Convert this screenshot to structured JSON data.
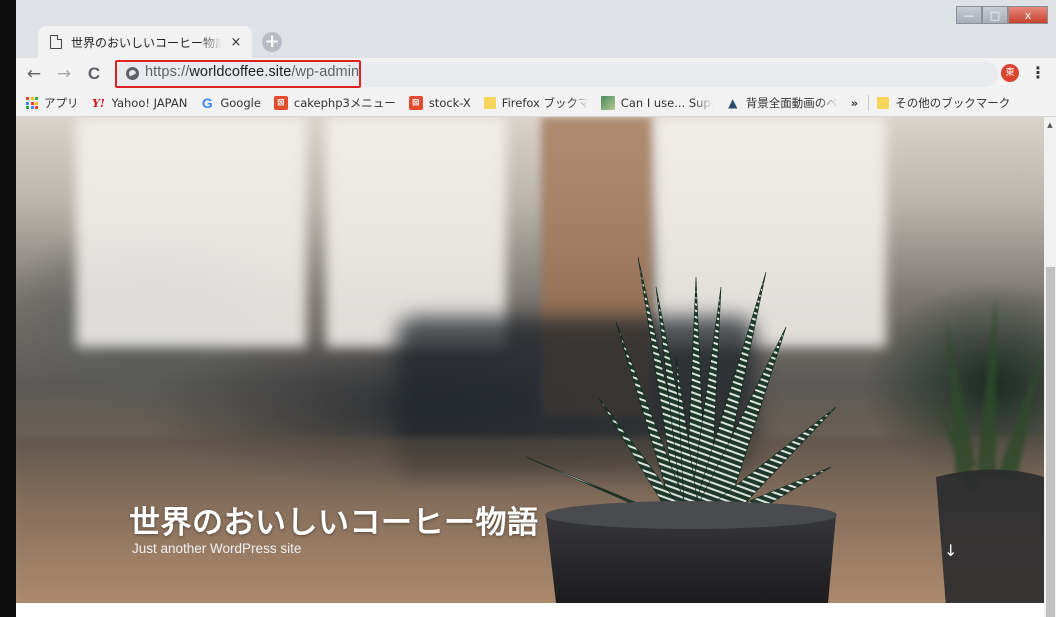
{
  "browser": {
    "tab": {
      "title": "世界のおいしいコーヒー物語 – Just another WordPress site",
      "close_glyph": "×"
    },
    "new_tab_glyph": "+",
    "window_controls": {
      "minimize": "—",
      "maximize": "□",
      "close": "x"
    },
    "nav": {
      "back": "←",
      "forward": "→",
      "reload": "C"
    },
    "address": {
      "scheme": "https://",
      "host": "worldcoffee.site",
      "path": "/wp-admin"
    },
    "profile_initial": "東",
    "menu_glyph": "⋮",
    "bookmarks": [
      {
        "label": "アプリ",
        "icon": "apps-grid-icon"
      },
      {
        "label": "Yahoo! JAPAN",
        "icon": "yahoo-icon",
        "glyph": "Y!"
      },
      {
        "label": "Google",
        "icon": "google-icon",
        "glyph": "G"
      },
      {
        "label": "cakephp3メニュー",
        "icon": "cakephp-icon",
        "glyph": "⊠"
      },
      {
        "label": "stock-X",
        "icon": "cakephp-icon",
        "glyph": "⊠"
      },
      {
        "label": "Firefox ブックマーク",
        "icon": "folder-icon"
      },
      {
        "label": "Can I use... Support",
        "icon": "image-icon"
      },
      {
        "label": "背景全面動画のページ",
        "icon": "mountain-icon",
        "glyph": "▲"
      }
    ],
    "bookmarks_more": "»",
    "other_bookmarks": "その他のブックマーク"
  },
  "page": {
    "site_title": "世界のおいしいコーヒー物語",
    "tagline": "Just another WordPress site",
    "scroll_down_glyph": "↓"
  },
  "colors": {
    "url_highlight": "#dd2222",
    "profile_bg": "#d9452f",
    "title_text": "#ffffff"
  }
}
